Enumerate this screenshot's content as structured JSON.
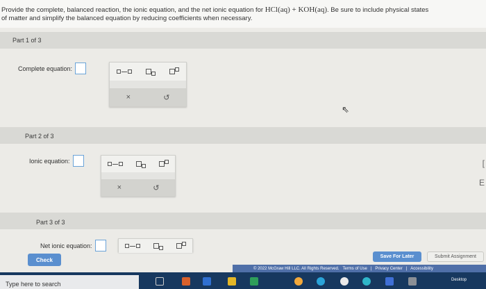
{
  "question": {
    "text_part1": "Provide the complete, balanced reaction, the ionic equation, and the net ionic equation for",
    "formula": "HCl(aq) + KOH(aq)",
    "text_part2": ". Be sure to include physical states",
    "text_line2": "of matter and simplify the balanced equation by reducing coefficients when necessary."
  },
  "parts": [
    {
      "label": "Part 1 of 3",
      "equation_label": "Complete equation:"
    },
    {
      "label": "Part 2 of 3",
      "equation_label": "Ionic equation:"
    },
    {
      "label": "Part 3 of 3",
      "equation_label": "Net ionic equation:"
    }
  ],
  "tools": {
    "clear": "×",
    "undo": "↺"
  },
  "buttons": {
    "check": "Check",
    "save": "Save For Later",
    "submit": "Submit Assignment"
  },
  "footer": {
    "copyright": "© 2022 McGraw Hill LLC. All Rights Reserved.",
    "terms": "Terms of Use",
    "privacy": "Privacy Center",
    "accessibility": "Accessibility"
  },
  "taskbar": {
    "search": "Type here to search",
    "desktop": "Desktop"
  },
  "colors": {
    "accent": "#5a8fcf",
    "taskbar": "#17385f",
    "footer": "#4f6fa8"
  }
}
